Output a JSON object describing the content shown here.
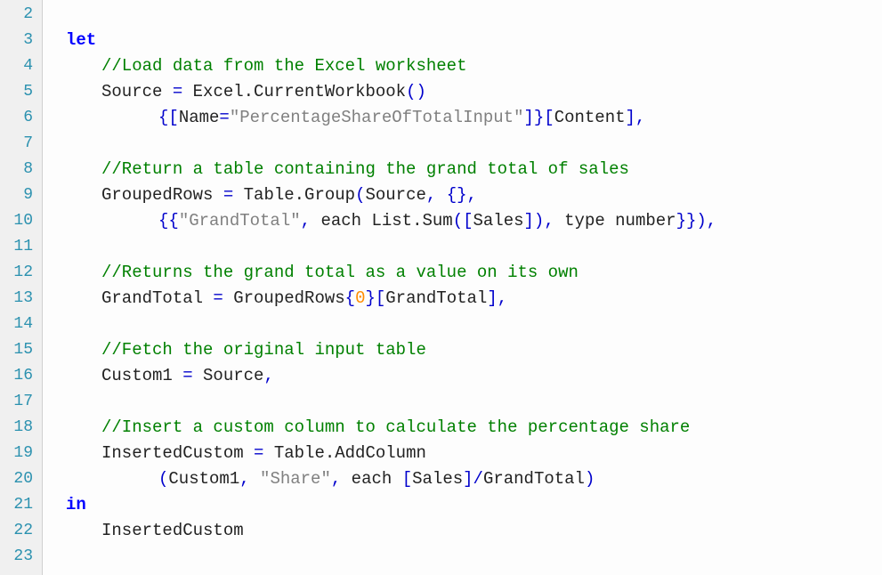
{
  "lines": [
    {
      "n": "2",
      "indent": "ind1",
      "tokens": []
    },
    {
      "n": "3",
      "indent": "ind1",
      "tokens": [
        [
          "kw",
          "let"
        ]
      ]
    },
    {
      "n": "4",
      "indent": "ind2",
      "tokens": [
        [
          "com",
          "//Load data from the Excel worksheet"
        ]
      ]
    },
    {
      "n": "5",
      "indent": "ind2",
      "tokens": [
        [
          "plain",
          "Source "
        ],
        [
          "punct",
          "="
        ],
        [
          "plain",
          " Excel.CurrentWorkbook"
        ],
        [
          "punct",
          "()"
        ]
      ]
    },
    {
      "n": "6",
      "indent": "ind3",
      "tokens": [
        [
          "punct",
          "{["
        ],
        [
          "plain",
          "Name"
        ],
        [
          "punct",
          "="
        ],
        [
          "str",
          "\"PercentageShareOfTotalInput\""
        ],
        [
          "punct",
          "]}["
        ],
        [
          "plain",
          "Content"
        ],
        [
          "punct",
          "],"
        ]
      ]
    },
    {
      "n": "7",
      "indent": "ind1",
      "tokens": []
    },
    {
      "n": "8",
      "indent": "ind2",
      "tokens": [
        [
          "com",
          "//Return a table containing the grand total of sales"
        ]
      ]
    },
    {
      "n": "9",
      "indent": "ind2",
      "tokens": [
        [
          "plain",
          "GroupedRows "
        ],
        [
          "punct",
          "="
        ],
        [
          "plain",
          " Table.Group"
        ],
        [
          "punct",
          "("
        ],
        [
          "plain",
          "Source"
        ],
        [
          "punct",
          ", {},"
        ]
      ]
    },
    {
      "n": "10",
      "indent": "ind3",
      "tokens": [
        [
          "punct",
          "{{"
        ],
        [
          "str",
          "\"GrandTotal\""
        ],
        [
          "punct",
          ","
        ],
        [
          "plain",
          " each List.Sum"
        ],
        [
          "punct",
          "(["
        ],
        [
          "plain",
          "Sales"
        ],
        [
          "punct",
          "]),"
        ],
        [
          "plain",
          " type number"
        ],
        [
          "punct",
          "}}),"
        ]
      ]
    },
    {
      "n": "11",
      "indent": "ind1",
      "tokens": []
    },
    {
      "n": "12",
      "indent": "ind2",
      "tokens": [
        [
          "com",
          "//Returns the grand total as a value on its own"
        ]
      ]
    },
    {
      "n": "13",
      "indent": "ind2",
      "tokens": [
        [
          "plain",
          "GrandTotal "
        ],
        [
          "punct",
          "="
        ],
        [
          "plain",
          " GroupedRows"
        ],
        [
          "punct",
          "{"
        ],
        [
          "num",
          "0"
        ],
        [
          "punct",
          "}["
        ],
        [
          "plain",
          "GrandTotal"
        ],
        [
          "punct",
          "],"
        ]
      ]
    },
    {
      "n": "14",
      "indent": "ind1",
      "tokens": []
    },
    {
      "n": "15",
      "indent": "ind2",
      "tokens": [
        [
          "com",
          "//Fetch the original input table"
        ]
      ]
    },
    {
      "n": "16",
      "indent": "ind2",
      "tokens": [
        [
          "plain",
          "Custom1 "
        ],
        [
          "punct",
          "="
        ],
        [
          "plain",
          " Source"
        ],
        [
          "punct",
          ","
        ]
      ]
    },
    {
      "n": "17",
      "indent": "ind1",
      "tokens": []
    },
    {
      "n": "18",
      "indent": "ind2",
      "tokens": [
        [
          "com",
          "//Insert a custom column to calculate the percentage share"
        ]
      ]
    },
    {
      "n": "19",
      "indent": "ind2",
      "tokens": [
        [
          "plain",
          "InsertedCustom "
        ],
        [
          "punct",
          "="
        ],
        [
          "plain",
          " Table.AddColumn"
        ]
      ]
    },
    {
      "n": "20",
      "indent": "ind3",
      "tokens": [
        [
          "punct",
          "("
        ],
        [
          "plain",
          "Custom1"
        ],
        [
          "punct",
          ", "
        ],
        [
          "str",
          "\"Share\""
        ],
        [
          "punct",
          ","
        ],
        [
          "plain",
          " each "
        ],
        [
          "punct",
          "["
        ],
        [
          "plain",
          "Sales"
        ],
        [
          "punct",
          "]/"
        ],
        [
          "plain",
          "GrandTotal"
        ],
        [
          "punct",
          ")"
        ]
      ]
    },
    {
      "n": "21",
      "indent": "ind1",
      "tokens": [
        [
          "kw",
          "in"
        ]
      ]
    },
    {
      "n": "22",
      "indent": "ind2",
      "tokens": [
        [
          "plain",
          "InsertedCustom"
        ]
      ]
    },
    {
      "n": "23",
      "indent": "ind1",
      "tokens": []
    }
  ]
}
